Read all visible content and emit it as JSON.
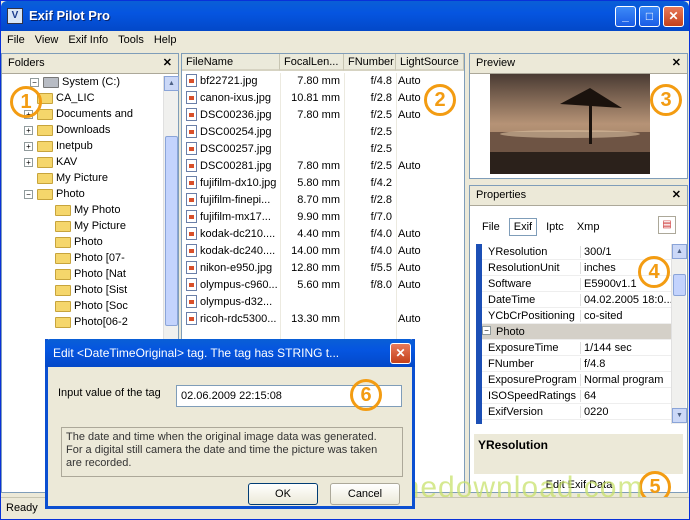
{
  "window": {
    "title": "Exif Pilot Pro",
    "app_icon": "V"
  },
  "menu": [
    {
      "label": "File"
    },
    {
      "label": "View"
    },
    {
      "label": "Exif Info"
    },
    {
      "label": "Tools"
    },
    {
      "label": "Help"
    }
  ],
  "folders": {
    "title": "Folders",
    "items": [
      {
        "label": "System (C:)",
        "level": 0,
        "expander": "minus",
        "icon": "drive-icon"
      },
      {
        "label": "CA_LIC",
        "level": 1,
        "expander": "",
        "icon": "folder-icon"
      },
      {
        "label": "Documents and",
        "level": 1,
        "expander": "plus",
        "icon": "folder-icon"
      },
      {
        "label": "Downloads",
        "level": 1,
        "expander": "plus",
        "icon": "folder-icon"
      },
      {
        "label": "Inetpub",
        "level": 1,
        "expander": "plus",
        "icon": "folder-icon"
      },
      {
        "label": "KAV",
        "level": 1,
        "expander": "plus",
        "icon": "folder-icon"
      },
      {
        "label": "My Picture",
        "level": 1,
        "expander": "",
        "icon": "folder-icon"
      },
      {
        "label": "Photo",
        "level": 1,
        "expander": "minus",
        "icon": "folder-icon"
      },
      {
        "label": "My Photo",
        "level": 2,
        "expander": "",
        "icon": "folder-icon"
      },
      {
        "label": "My Picture",
        "level": 2,
        "expander": "",
        "icon": "folder-icon"
      },
      {
        "label": "Photo",
        "level": 2,
        "expander": "",
        "icon": "folder-icon"
      },
      {
        "label": "Photo [07-",
        "level": 2,
        "expander": "",
        "icon": "folder-icon"
      },
      {
        "label": "Photo [Nat",
        "level": 2,
        "expander": "",
        "icon": "folder-icon"
      },
      {
        "label": "Photo [Sist",
        "level": 2,
        "expander": "",
        "icon": "folder-icon"
      },
      {
        "label": "Photo [Soc",
        "level": 2,
        "expander": "",
        "icon": "folder-icon"
      },
      {
        "label": "Photo[06-2",
        "level": 2,
        "expander": "",
        "icon": "folder-icon"
      }
    ]
  },
  "files": {
    "columns": [
      "FileName",
      "FocalLen...",
      "FNumber",
      "LightSource"
    ],
    "rows": [
      [
        "bf22721.jpg",
        "7.80 mm",
        "f/4.8",
        "Auto"
      ],
      [
        "canon-ixus.jpg",
        "10.81 mm",
        "f/2.8",
        "Auto"
      ],
      [
        "DSC00236.jpg",
        "7.80 mm",
        "f/2.5",
        "Auto"
      ],
      [
        "DSC00254.jpg",
        "",
        "f/2.5",
        ""
      ],
      [
        "DSC00257.jpg",
        "",
        "f/2.5",
        ""
      ],
      [
        "DSC00281.jpg",
        "7.80 mm",
        "f/2.5",
        "Auto"
      ],
      [
        "fujifilm-dx10.jpg",
        "5.80 mm",
        "f/4.2",
        ""
      ],
      [
        "fujifilm-finepi...",
        "8.70 mm",
        "f/2.8",
        ""
      ],
      [
        "fujifilm-mx17...",
        "9.90 mm",
        "f/7.0",
        ""
      ],
      [
        "kodak-dc210....",
        "4.40 mm",
        "f/4.0",
        "Auto"
      ],
      [
        "kodak-dc240....",
        "14.00 mm",
        "f/4.0",
        "Auto"
      ],
      [
        "nikon-e950.jpg",
        "12.80 mm",
        "f/5.5",
        "Auto"
      ],
      [
        "olympus-c960...",
        "5.60 mm",
        "f/8.0",
        "Auto"
      ],
      [
        "olympus-d32...",
        "",
        "",
        ""
      ],
      [
        "ricoh-rdc5300...",
        "13.30 mm",
        "",
        "Auto"
      ]
    ]
  },
  "preview": {
    "title": "Preview"
  },
  "properties": {
    "title": "Properties",
    "tabs": [
      "File",
      "Exif",
      "Iptc",
      "Xmp"
    ],
    "active_tab": "Exif",
    "rows": [
      {
        "key": "YResolution",
        "value": "300/1",
        "group": false
      },
      {
        "key": "ResolutionUnit",
        "value": "inches",
        "group": false
      },
      {
        "key": "Software",
        "value": "E5900v1.1",
        "group": false
      },
      {
        "key": "DateTime",
        "value": "04.02.2005 18:0...",
        "group": false
      },
      {
        "key": "YCbCrPositioning",
        "value": "co-sited",
        "group": false
      },
      {
        "key": "Photo",
        "value": "",
        "group": true
      },
      {
        "key": "ExposureTime",
        "value": "1/144 sec",
        "group": false
      },
      {
        "key": "FNumber",
        "value": "f/4.8",
        "group": false
      },
      {
        "key": "ExposureProgram",
        "value": "Normal program",
        "group": false
      },
      {
        "key": "ISOSpeedRatings",
        "value": "64",
        "group": false
      },
      {
        "key": "ExifVersion",
        "value": "0220",
        "group": false
      }
    ],
    "description_title": "YResolution",
    "edit_button": "Edit Exif Data"
  },
  "dialog": {
    "title": "Edit <DateTimeOriginal> tag. The tag has STRING t...",
    "input_label": "Input value of the tag",
    "input_value": "02.06.2009 22:15:08",
    "description": "The date and time when the original image data was generated. For a digital still camera the date and time the picture was taken are recorded.",
    "ok_label": "OK",
    "cancel_label": "Cancel"
  },
  "callouts": [
    "1",
    "2",
    "3",
    "4",
    "5",
    "6"
  ],
  "status": "Ready",
  "watermark": "limedownload.com",
  "colors": {
    "accent": "#0555e0",
    "callout": "#f39c12"
  }
}
